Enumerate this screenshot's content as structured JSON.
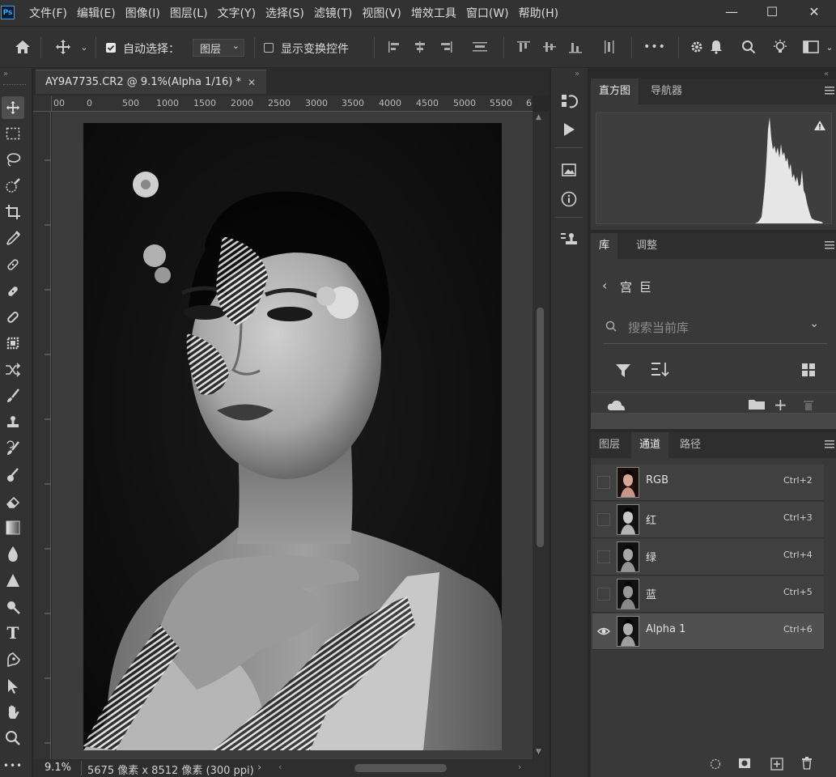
{
  "app": {
    "logo": "Ps"
  },
  "menu": [
    "文件(F)",
    "编辑(E)",
    "图像(I)",
    "图层(L)",
    "文字(Y)",
    "选择(S)",
    "滤镜(T)",
    "视图(V)",
    "增效工具",
    "窗口(W)",
    "帮助(H)"
  ],
  "window_controls": {
    "minimize": "—",
    "maximize": "☐",
    "close": "✕"
  },
  "options": {
    "auto_select_label": "自动选择：",
    "auto_select_checked": true,
    "auto_select_target": "图层",
    "show_transform_label": "显示变换控件",
    "show_transform_checked": false,
    "more": "•••"
  },
  "document": {
    "tab_title": "AY9A7735.CR2 @ 9.1%(Alpha 1/16) *",
    "ruler_ticks": [
      "00",
      "0",
      "500",
      "1000",
      "1500",
      "2000",
      "2500",
      "3000",
      "3500",
      "4000",
      "4500",
      "5000",
      "5500",
      "6"
    ],
    "zoom": "9.1%",
    "doc_info": "5675 像素 x 8512 像素 (300 ppi)"
  },
  "panels": {
    "histogram_tabs": [
      "直方图",
      "导航器"
    ],
    "library_tabs": [
      "库",
      "调整"
    ],
    "library": {
      "breadcrumb": "宫 巨",
      "search_placeholder": "搜索当前库"
    },
    "channels_tabs": [
      "图层",
      "通道",
      "路径"
    ],
    "channels": [
      {
        "name": "RGB",
        "shortcut": "Ctrl+2",
        "visible": false
      },
      {
        "name": "红",
        "shortcut": "Ctrl+3",
        "visible": false
      },
      {
        "name": "绿",
        "shortcut": "Ctrl+4",
        "visible": false
      },
      {
        "name": "蓝",
        "shortcut": "Ctrl+5",
        "visible": false
      },
      {
        "name": "Alpha 1",
        "shortcut": "Ctrl+6",
        "visible": true
      }
    ]
  },
  "colors": {
    "accent": "#31a8ff",
    "panel": "#393939",
    "bg": "#282828"
  }
}
